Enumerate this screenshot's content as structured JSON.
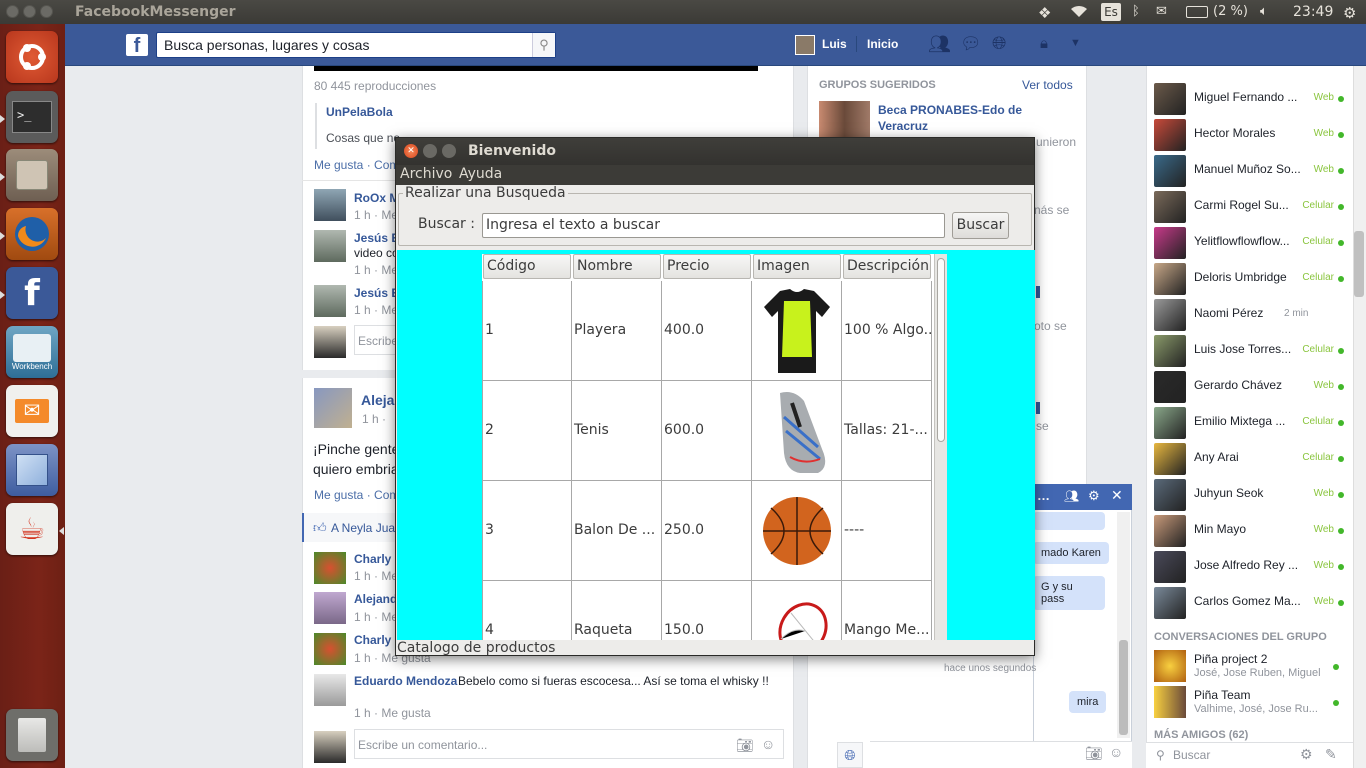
{
  "top_panel": {
    "app_title": "FacebookMessenger",
    "keyboard": "Es",
    "battery": "(2 %)",
    "clock": "23:49"
  },
  "launcher": {
    "items": [
      "ubuntu-dash",
      "terminal",
      "file-manager",
      "firefox",
      "facebook",
      "mysql-workbench",
      "mail",
      "virtualbox",
      "java",
      "trash"
    ],
    "workbench_label": "Workbench"
  },
  "fb_header": {
    "search_placeholder": "Busca personas, lugares y cosas",
    "user_name": "Luis",
    "home_label": "Inicio"
  },
  "feed": {
    "views": "80 445 reproducciones",
    "page_name": "UnPelaBola",
    "snippet": "Cosas que no",
    "like_comment_1": "Me gusta · Com",
    "comment_1_name": "RoOx M",
    "comment_1_meta": "1 h · Me",
    "comment_2_name": "Jesús E",
    "comment_2_text": "video co",
    "comment_2_meta": "1 h · Me",
    "comment_3_name": "Jesús E",
    "comment_3_meta": "1 h · Me",
    "write_comment_1": "Escribe",
    "post2_author": "Aleja",
    "post2_meta": "1 h ·",
    "post2_text_1": "¡Pinche gente",
    "post2_text_2": "quiero embria",
    "like_comment_2": "Me gusta · Com",
    "likes_line": "A Neyla Jua",
    "c4_name": "Charly",
    "c4_meta": "1 h · Me",
    "c5_name": "Alejand",
    "c5_meta": "1 h · Me",
    "c6_name": "Charly",
    "c6_meta": "1 h · Me gusta",
    "c7_name": "Eduardo Mendoza",
    "c7_text": "Bebelo como si fueras escocesa... Así se toma el whisky !!",
    "c7_meta": "1 h · Me gusta",
    "write_comment_2": "Escribe un comentario..."
  },
  "right_col": {
    "groups_title": "GRUPOS SUGERIDOS",
    "see_all": "Ver todos",
    "group_name": "Beca PRONABES-Edo de Veracruz",
    "frag_1": "unieron",
    "frag_2": "nás se",
    "frag_3": "oto se",
    "frag_4": "se"
  },
  "chat_sidebar": {
    "friends": [
      {
        "name": "Miguel Fernando ...",
        "status": "Web"
      },
      {
        "name": "Hector Morales",
        "status": "Web"
      },
      {
        "name": "Manuel Muñoz So...",
        "status": "Web"
      },
      {
        "name": "Carmi Rogel Su...",
        "status": "Celular"
      },
      {
        "name": "Yelitflowflowflow...",
        "status": "Celular"
      },
      {
        "name": "Deloris Umbridge",
        "status": "Celular"
      },
      {
        "name": "Naomi Pérez",
        "status": "2 min"
      },
      {
        "name": "Luis Jose Torres...",
        "status": "Celular"
      },
      {
        "name": "Gerardo Chávez",
        "status": "Web"
      },
      {
        "name": "Emilio Mixtega ...",
        "status": "Celular"
      },
      {
        "name": "Any Arai",
        "status": "Celular"
      },
      {
        "name": "Juhyun Seok",
        "status": "Web"
      },
      {
        "name": "Min Mayo",
        "status": "Web"
      },
      {
        "name": "Jose Alfredo Rey ...",
        "status": "Web"
      },
      {
        "name": "Carlos Gomez Ma...",
        "status": "Web"
      }
    ],
    "group_convs_title": "CONVERSACIONES DEL GRUPO",
    "groups": [
      {
        "name": "Piña project 2",
        "members": "José, Jose Ruben, Miguel"
      },
      {
        "name": "Piña Team",
        "members": "Valhime, José, Jose Ru..."
      }
    ],
    "more_friends": "MÁS AMIGOS (62)",
    "search_placeholder": "Buscar"
  },
  "chat_tab": {
    "msg_1": "mado Karen",
    "msg_2": "G y su pass",
    "time": "hace unos segundos",
    "msg_3": "mira"
  },
  "dialog": {
    "title": "Bienvenido",
    "menu": [
      "Archivo",
      "Ayuda"
    ],
    "group_legend": "Realizar una Busqueda",
    "search_label": "Buscar :",
    "search_value": "Ingresa el texto a buscar",
    "search_button": "Buscar",
    "columns": [
      "Código",
      "Nombre",
      "Precio",
      "Imagen",
      "Descripción"
    ],
    "rows": [
      {
        "code": "1",
        "name": "Playera",
        "price": "400.0",
        "image": "tshirt",
        "desc": "100 % Algo..."
      },
      {
        "code": "2",
        "name": "Tenis",
        "price": "600.0",
        "image": "sneaker",
        "desc": "Tallas: 21-..."
      },
      {
        "code": "3",
        "name": "Balon De ...",
        "price": "250.0",
        "image": "basketball",
        "desc": "----"
      },
      {
        "code": "4",
        "name": "Raqueta",
        "price": "150.0",
        "image": "racket",
        "desc": "Mango Me..."
      }
    ],
    "status": "Catalogo de productos"
  }
}
